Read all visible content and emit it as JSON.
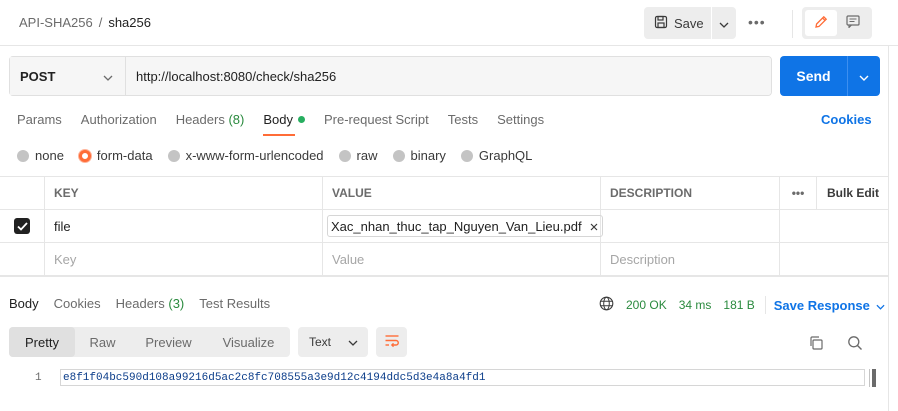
{
  "header": {
    "collection": "API-SHA256",
    "separator": "/",
    "request_name": "sha256",
    "save_label": "Save",
    "more_label": "•••"
  },
  "request": {
    "method": "POST",
    "url": "http://localhost:8080/check/sha256",
    "send_label": "Send"
  },
  "req_tabs": {
    "params": "Params",
    "authorization": "Authorization",
    "headers": "Headers",
    "headers_count": "(8)",
    "body": "Body",
    "prerequest": "Pre-request Script",
    "tests": "Tests",
    "settings": "Settings",
    "cookies": "Cookies"
  },
  "body_types": {
    "none": "none",
    "form_data": "form-data",
    "urlencoded": "x-www-form-urlencoded",
    "raw": "raw",
    "binary": "binary",
    "graphql": "GraphQL",
    "selected": "form-data"
  },
  "kv_table": {
    "headers": {
      "key": "KEY",
      "value": "VALUE",
      "description": "DESCRIPTION",
      "more": "•••",
      "bulk_edit": "Bulk Edit"
    },
    "rows": [
      {
        "key": "file",
        "value": "Xac_nhan_thuc_tap_Nguyen_Van_Lieu.pdf",
        "description": "",
        "checked": true
      }
    ],
    "placeholder": {
      "key": "Key",
      "value": "Value",
      "description": "Description"
    }
  },
  "response": {
    "tabs": {
      "body": "Body",
      "cookies": "Cookies",
      "headers": "Headers",
      "headers_count": "(3)",
      "test_results": "Test Results"
    },
    "status": "200 OK",
    "time": "34 ms",
    "size": "181 B",
    "save_response": "Save Response",
    "views": {
      "pretty": "Pretty",
      "raw": "Raw",
      "preview": "Preview",
      "visualize": "Visualize"
    },
    "format": "Text",
    "lines": [
      {
        "number": "1",
        "text": "e8f1f04bc590d108a99216d5ac2c8fc708555a3e9d12c4194ddc5d3e4a8a4fd1"
      }
    ]
  },
  "colors": {
    "accent": "#ff6c37",
    "primary": "#0f74e6",
    "success": "#2a8a3e"
  }
}
